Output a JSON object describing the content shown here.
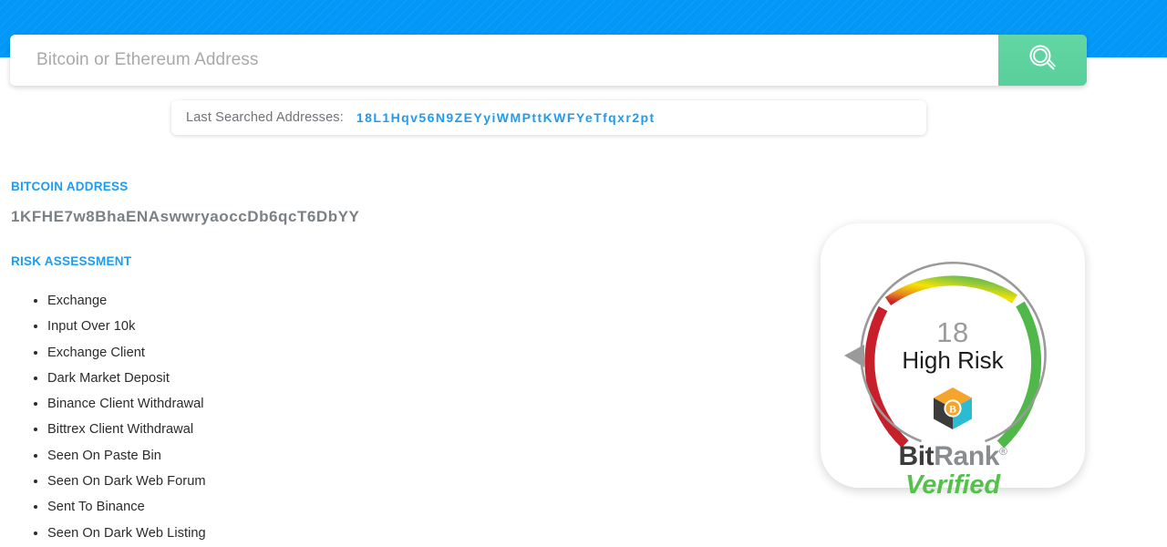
{
  "header": {
    "band_color": "#0398f7"
  },
  "search": {
    "placeholder": "Bitcoin or Ethereum Address",
    "value": "",
    "button_icon": "search-icon",
    "button_color": "#5ed5a0"
  },
  "last_searched": {
    "label": "Last Searched Addresses:",
    "addresses": [
      "18L1Hqv56N9ZEYyiWMPttKWFYeTfqxr2pt"
    ]
  },
  "result": {
    "address_heading": "BITCOIN ADDRESS",
    "address": "1KFHE7w8BhaENAswwryaoccDb6qcT6DbYY",
    "risk_heading": "RISK ASSESSMENT",
    "risk_items": [
      "Exchange",
      "Input Over 10k",
      "Exchange Client",
      "Dark Market Deposit",
      "Binance Client Withdrawal",
      "Bittrex Client Withdrawal",
      "Seen On Paste Bin",
      "Seen On Dark Web Forum",
      "Sent To Binance",
      "Seen On Dark Web Listing"
    ]
  },
  "gauge": {
    "score": "18",
    "score_min": 0,
    "score_max": 100,
    "risk_label": "High Risk",
    "brand_bit": "Bit",
    "brand_rank": "Rank",
    "brand_registered": "®",
    "brand_verified": "Verified",
    "colors": {
      "low": "#c8202a",
      "mid_orange": "#e8871d",
      "mid_yellow": "#f5e400",
      "high": "#4fb848",
      "track": "#9a9a9a",
      "pointer": "#9a9a9a"
    }
  }
}
